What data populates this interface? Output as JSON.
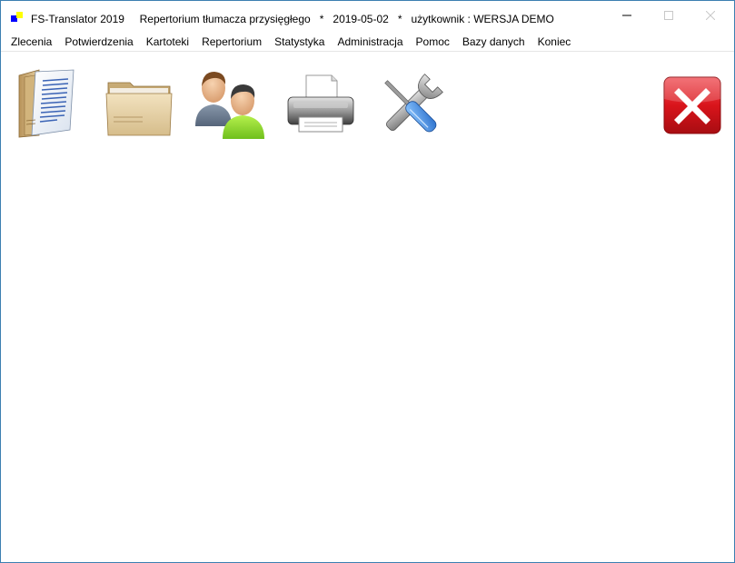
{
  "window": {
    "app_name": "FS-Translator 2019",
    "subtitle": "Repertorium tłumacza przysięgłego",
    "separator": "*",
    "date": "2019-05-02",
    "user_label": "użytkownik :",
    "user_name": "WERSJA DEMO",
    "controls": [
      "minimize-icon",
      "maximize-icon",
      "close-icon"
    ]
  },
  "menu": {
    "items": [
      "Zlecenia",
      "Potwierdzenia",
      "Kartoteki",
      "Repertorium",
      "Statystyka",
      "Administracja",
      "Pomoc",
      "Bazy danych",
      "Koniec"
    ]
  },
  "toolbar": {
    "buttons": [
      {
        "name": "documents",
        "icon": "documents-icon"
      },
      {
        "name": "folder",
        "icon": "folder-icon"
      },
      {
        "name": "users",
        "icon": "users-icon"
      },
      {
        "name": "print",
        "icon": "printer-icon"
      },
      {
        "name": "settings",
        "icon": "tools-icon"
      },
      {
        "name": "exit",
        "icon": "exit-icon"
      }
    ]
  },
  "colors": {
    "window_border": "#3c7fb1",
    "exit_red": "#d9141b"
  }
}
